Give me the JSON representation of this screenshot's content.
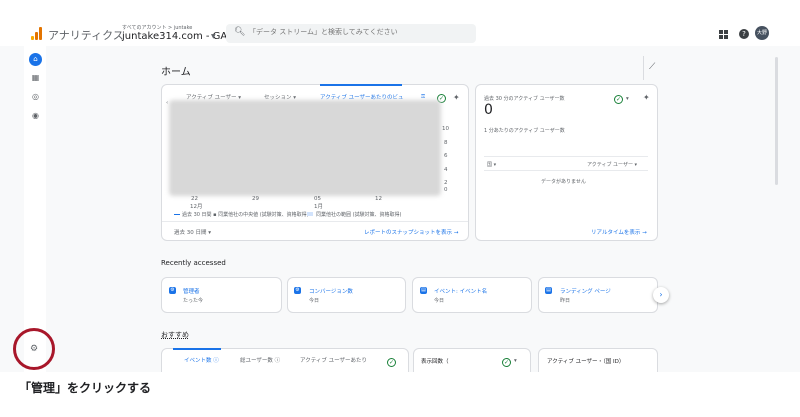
{
  "app": {
    "title": "アナリティクス",
    "account_path": "すべてのアカウント > juntake",
    "property_name": "juntake314.com - GA4",
    "avatar_initials": "大野"
  },
  "search": {
    "placeholder": "「データ ストリーム」と検索してみてください"
  },
  "page": {
    "title": "ホーム"
  },
  "overview_card": {
    "tabs": [
      "アクティブ ユーザー",
      "セッション",
      "アクティブ ユーザーあたりのビュ"
    ],
    "y_ticks": [
      "10",
      "8",
      "6",
      "4",
      "2",
      "0"
    ],
    "x_ticks": [
      {
        "d": "22",
        "m": "12月"
      },
      {
        "d": "29",
        "m": ""
      },
      {
        "d": "05",
        "m": "1月"
      },
      {
        "d": "12",
        "m": ""
      }
    ],
    "legend_1": "過去 30 日間 ▪ 同業他社の中央値 (試験対策、資格取得)",
    "legend_2": "同業他社の範囲 (試験対策、資格取得)",
    "date_range": "過去 30 日間",
    "link": "レポートのスナップショットを表示 →"
  },
  "realtime_card": {
    "title": "過去 30 分のアクティブ ユーザー数",
    "value": "0",
    "subtitle": "1 分あたりのアクティブ ユーザー数",
    "col_country": "国",
    "col_users": "アクティブ ユーザー",
    "empty": "データがありません",
    "link": "リアルタイムを表示 →"
  },
  "recent": {
    "heading": "Recently accessed",
    "items": [
      {
        "title": "管理者",
        "sub": "たった今"
      },
      {
        "title": "コンバージョン数",
        "sub": "今日"
      },
      {
        "title": "イベント: イベント名",
        "sub": "今日"
      },
      {
        "title": "ランディング ページ",
        "sub": "昨日"
      }
    ]
  },
  "recommended": {
    "heading": "おすすめ",
    "tabs": [
      "イベント数 ⓘ",
      "総ユーザー数 ⓘ",
      "アクティブ ユーザーあたり"
    ],
    "card2_title": "表示回数（",
    "card3_title": "アクティブ ユーザー・（国 ID）"
  },
  "caption": "「管理」をクリックする",
  "colors": {
    "accent": "#1a73e8",
    "highlight_ring": "#a8172a"
  }
}
